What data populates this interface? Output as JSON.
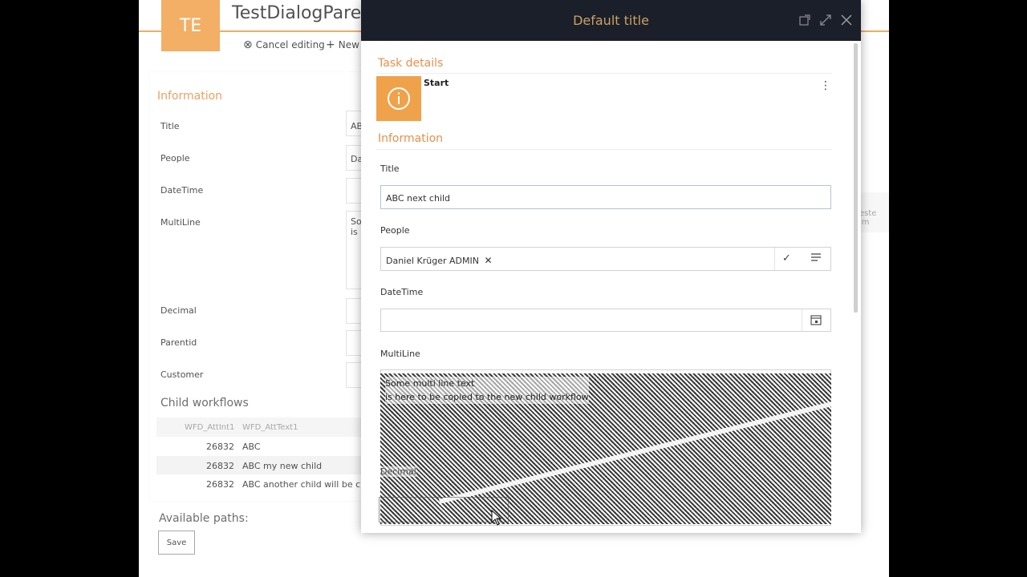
{
  "background_page": {
    "tile_text": "TE",
    "title": "TestDialogParen",
    "commands": [
      {
        "label": "Cancel editing",
        "icon": "cancel-circle-icon"
      },
      {
        "label": "New",
        "icon": "plus-icon"
      }
    ],
    "info_section": "Information",
    "fields": [
      {
        "label": "Title",
        "value": "AB"
      },
      {
        "label": "People",
        "value": "Da"
      },
      {
        "label": "DateTime",
        "value": ""
      },
      {
        "label": "MultiLine",
        "value": "So\nis"
      },
      {
        "label": "Decimal",
        "value": ""
      },
      {
        "label": "Parentid",
        "value": ""
      },
      {
        "label": "Customer",
        "value": ""
      }
    ],
    "child_section": "Child workflows",
    "child_columns": [
      "WFD_AttInt1",
      "WFD_AttText1"
    ],
    "child_rows": [
      {
        "int": "26832",
        "text": "ABC"
      },
      {
        "int": "26832",
        "text": "ABC my new child"
      },
      {
        "int": "26832",
        "text": "ABC another child will be crea"
      }
    ],
    "available_paths": "Available paths:",
    "save_label": "Save",
    "right_hint": "este im"
  },
  "dialog": {
    "title": "Default title",
    "icons": [
      "popout-icon",
      "expand-icon",
      "close-icon"
    ],
    "task_details": "Task details",
    "step_label": "Start",
    "more_icon": "more-vertical-icon",
    "info_section": "Information",
    "title_label": "Title",
    "title_value": "ABC next child",
    "people_label": "People",
    "people_value": "Daniel Krüger ADMIN",
    "datetime_label": "DateTime",
    "datetime_value": "",
    "multiline_label": "MultiLine",
    "multiline_value": "Some multi line text\nis here to be copied to the new child workflow",
    "decimal_label": "Decimal"
  },
  "colors": {
    "accent": "#e8904a",
    "tile": "#f0a24a",
    "dialog_bar": "#1b1f29",
    "dialog_title": "#c9a165"
  }
}
